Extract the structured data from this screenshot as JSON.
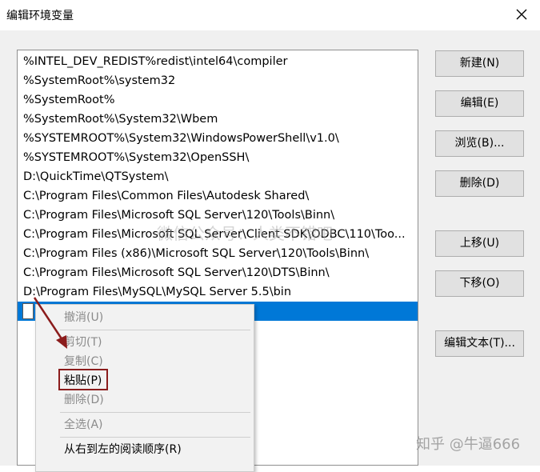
{
  "window": {
    "title": "编辑环境变量"
  },
  "paths": [
    "%INTEL_DEV_REDIST%redist\\intel64\\compiler",
    "%SystemRoot%\\system32",
    "%SystemRoot%",
    "%SystemRoot%\\System32\\Wbem",
    "%SYSTEMROOT%\\System32\\WindowsPowerShell\\v1.0\\",
    "%SYSTEMROOT%\\System32\\OpenSSH\\",
    "D:\\QuickTime\\QTSystem\\",
    "C:\\Program Files\\Common Files\\Autodesk Shared\\",
    "C:\\Program Files\\Microsoft SQL Server\\120\\Tools\\Binn\\",
    "C:\\Program Files\\Microsoft SQL Server\\Client SDK\\ODBC\\110\\Too...",
    "C:\\Program Files (x86)\\Microsoft SQL Server\\120\\Tools\\Binn\\",
    "C:\\Program Files\\Microsoft SQL Server\\120\\DTS\\Binn\\",
    "D:\\Program Files\\MySQL\\MySQL Server 5.5\\bin"
  ],
  "buttons": {
    "new": "新建(N)",
    "edit": "编辑(E)",
    "browse": "浏览(B)...",
    "delete": "删除(D)",
    "move_up": "上移(U)",
    "move_down": "下移(O)",
    "edit_text": "编辑文本(T)..."
  },
  "context_menu": {
    "undo": "撤消(U)",
    "cut": "剪切(T)",
    "copy": "复制(C)",
    "paste": "粘贴(P)",
    "delete": "删除(D)",
    "select_all": "全选(A)",
    "rtl_reading": "从右到左的阅读顺序(R)"
  },
  "watermarks": {
    "center": "微信公众号：人类不错吧",
    "corner": "知乎 @牛逼666"
  },
  "colors": {
    "selection": "#0078d7",
    "highlight_box": "#8b1c1c",
    "arrow": "#8b1c1c"
  }
}
